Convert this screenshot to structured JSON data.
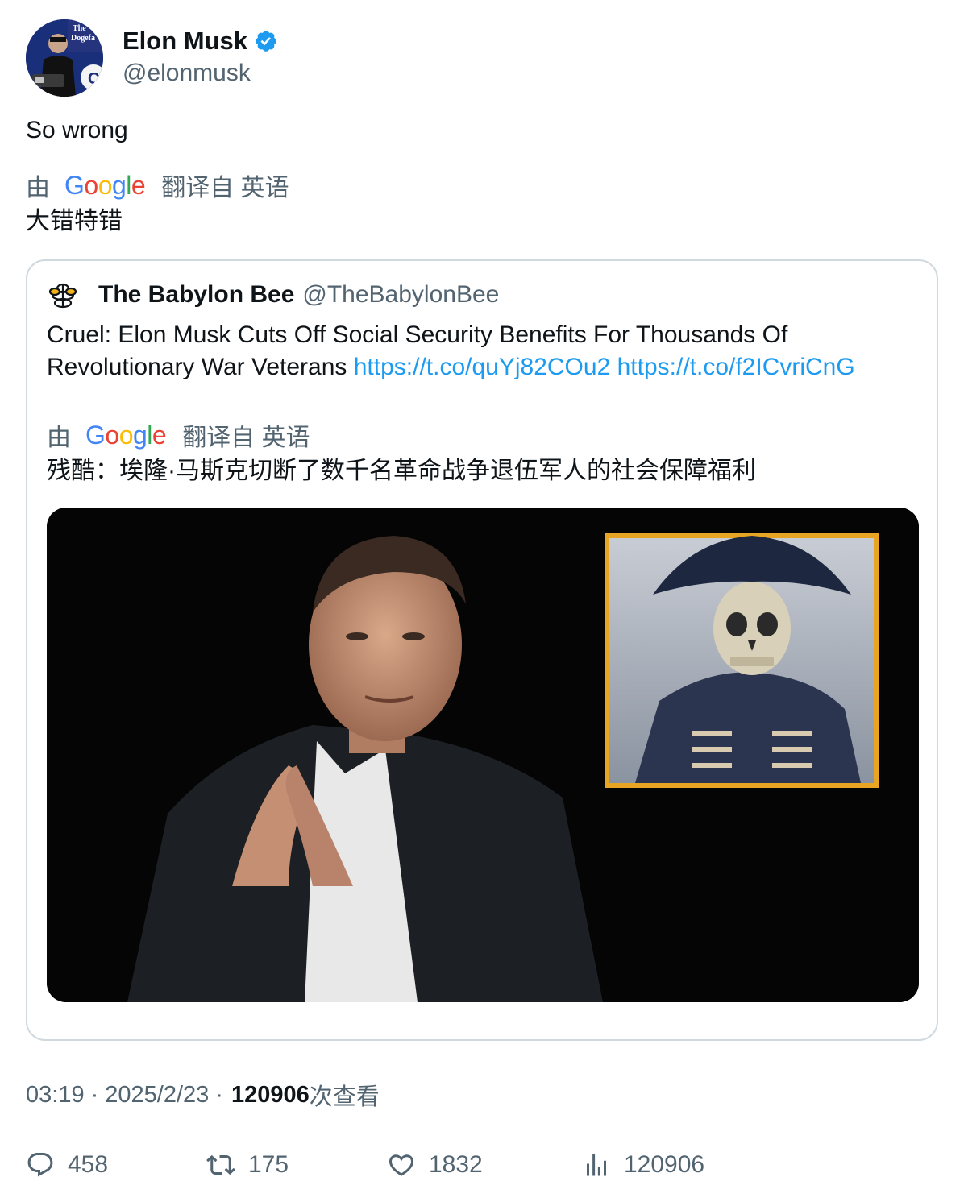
{
  "author": {
    "display_name": "Elon Musk",
    "handle": "@elonmusk",
    "verified": true
  },
  "tweet": {
    "text": "So wrong",
    "translation": {
      "by": "由",
      "provider": "Google",
      "from_label": "翻译自 英语",
      "text": "大错特错"
    }
  },
  "quoted_tweet": {
    "author_name": "The Babylon Bee",
    "author_handle": "@TheBabylonBee",
    "text": "Cruel: Elon Musk Cuts Off Social Security Benefits For Thousands Of Revolutionary War Veterans",
    "links": [
      "https://t.co/quYj82COu2",
      "https://t.co/f2ICvriCnG"
    ],
    "translation": {
      "by": "由",
      "provider": "Google",
      "from_label": "翻译自 英语",
      "text": "残酷：埃隆·马斯克切断了数千名革命战争退伍军人的社会保障福利"
    }
  },
  "meta": {
    "time": "03:19",
    "separator": "·",
    "date": "2025/2/23",
    "views_count": "120906",
    "views_label": "次查看"
  },
  "actions": {
    "replies": "458",
    "retweets": "175",
    "likes": "1832",
    "views": "120906"
  },
  "colors": {
    "link": "#1d9bf0",
    "secondary_text": "#536471",
    "verified_badge": "#1d9bf0",
    "border": "#cfd9de"
  }
}
